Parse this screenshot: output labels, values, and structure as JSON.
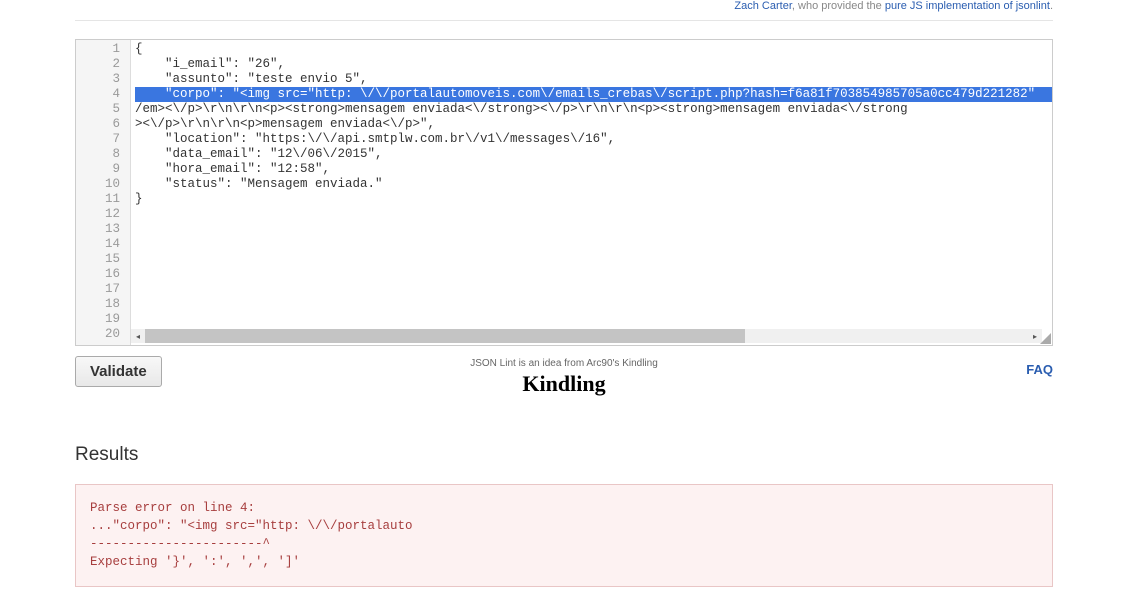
{
  "top_credits": {
    "name_link": "Zach Carter",
    "trail_text": ", who provided the ",
    "pure_link": "pure JS implementation of jsonlint"
  },
  "code": {
    "line_numbers": [
      "1",
      "2",
      "3",
      "4",
      "5",
      "6",
      "7",
      "8",
      "9",
      "10",
      "11",
      "12",
      "13",
      "14",
      "15",
      "16",
      "17",
      "18",
      "19",
      "20"
    ],
    "lines": [
      "{",
      "    \"i_email\": \"26\",",
      "    \"assunto\": \"teste envio 5\",",
      "    \"corpo\": \"<img src=\"http: \\/\\/portalautomoveis.com\\/emails_crebas\\/script.php?hash=f6a81f703854985705a0cc479d221282\"",
      "/em><\\/p>\\r\\n\\r\\n<p><strong>mensagem enviada<\\/strong><\\/p>\\r\\n\\r\\n<p><strong>mensagem enviada<\\/strong",
      "><\\/p>\\r\\n\\r\\n<p>mensagem enviada<\\/p>\",",
      "    \"location\": \"https:\\/\\/api.smtplw.com.br\\/v1\\/messages\\/16\",",
      "    \"data_email\": \"12\\/06\\/2015\",",
      "    \"hora_email\": \"12:58\",",
      "    \"status\": \"Mensagem enviada.\"",
      "}",
      "",
      "",
      "",
      "",
      "",
      "",
      "",
      "",
      ""
    ],
    "highlight_index": 3
  },
  "buttons": {
    "validate": "Validate"
  },
  "credits": {
    "text": "JSON Lint is an idea from Arc90's Kindling",
    "logo": "Kindling"
  },
  "faq_label": "FAQ",
  "results": {
    "heading": "Results",
    "body": "Parse error on line 4:\n...\"corpo\": \"<img src=\"http: \\/\\/portalauto\n-----------------------^\nExpecting '}', ':', ',', ']'"
  }
}
